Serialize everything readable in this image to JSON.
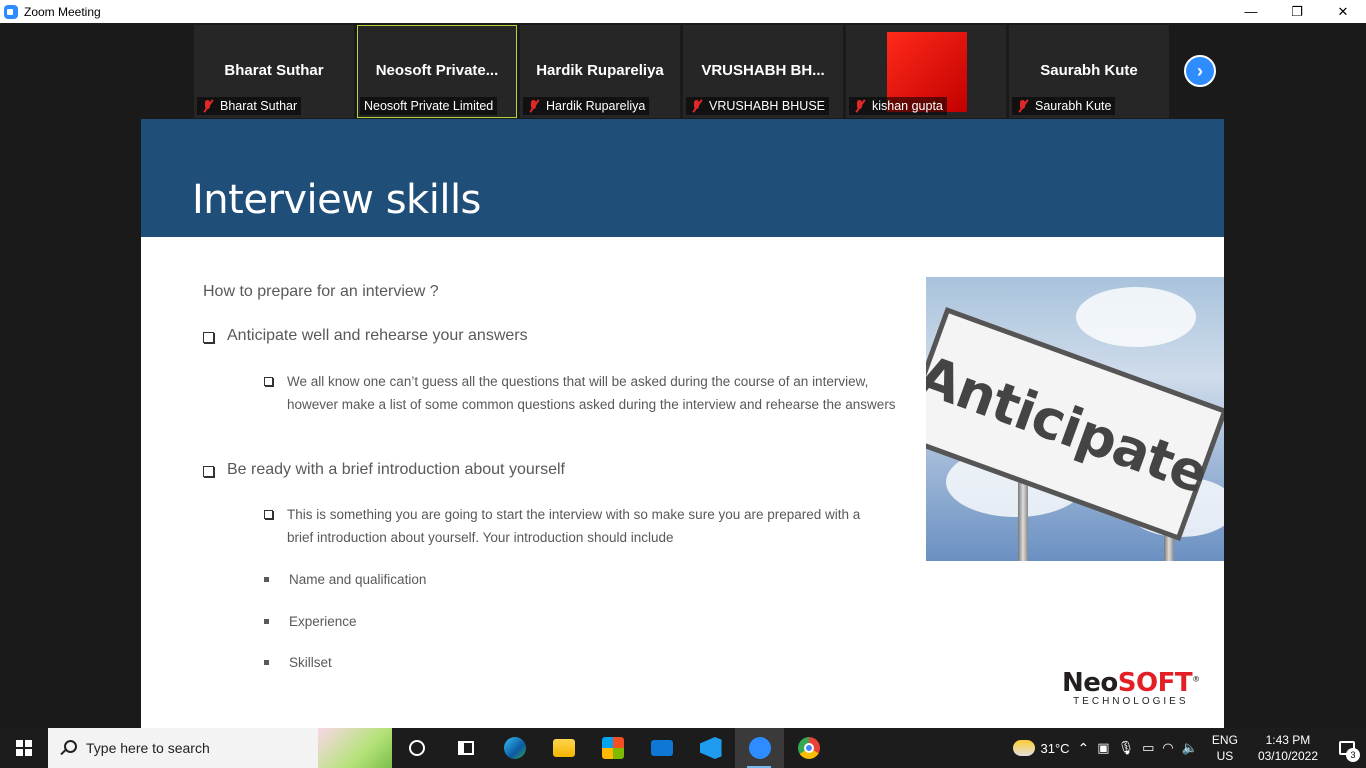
{
  "window": {
    "title": "Zoom Meeting",
    "minimize": "—",
    "restore": "❐",
    "close": "✕"
  },
  "participants": [
    {
      "display": "Bharat Suthar",
      "label": "Bharat Suthar",
      "muted": true
    },
    {
      "display": "Neosoft  Private...",
      "label": "Neosoft Private Limited",
      "muted": false
    },
    {
      "display": "Hardik Rupareliya",
      "label": "Hardik Rupareliya",
      "muted": true
    },
    {
      "display": "VRUSHABH  BH...",
      "label": "VRUSHABH BHUSE",
      "muted": true
    },
    {
      "display": "",
      "label": "kishan gupta",
      "muted": true
    },
    {
      "display": "Saurabh Kute",
      "label": "Saurabh Kute",
      "muted": true
    }
  ],
  "next_arrow": "›",
  "slide": {
    "title": "Interview skills",
    "question": "How to prepare for an interview ?",
    "point1": "Anticipate well and rehearse your answers",
    "point1_sub": "We all know one can’t guess all the questions that will be asked during the course of an interview, however make a list of some common questions asked during the interview and rehearse the answers",
    "point2": "Be ready with a brief introduction about yourself",
    "point2_sub": "This is something you are going to start the interview with so make sure you are prepared with a brief introduction about yourself. Your introduction should include",
    "items": [
      "Name and qualification",
      "Experience",
      "Skillset"
    ],
    "sign_text": "Anticipate",
    "logo_neo": "Neo",
    "logo_soft": "SOFT",
    "logo_reg": "®",
    "logo_tag": "TECHNOLOGIES"
  },
  "taskbar": {
    "search_placeholder": "Type here to search",
    "weather": "31°C",
    "lang1": "ENG",
    "lang2": "US",
    "time": "1:43 PM",
    "date": "03/10/2022",
    "notifications": "3"
  },
  "colors": {
    "slide_header": "#1f4e79",
    "zoom_blue": "#2d8cff",
    "active_speaker": "#b6d33a",
    "mute_red": "#e02828",
    "logo_red": "#e31e24"
  }
}
